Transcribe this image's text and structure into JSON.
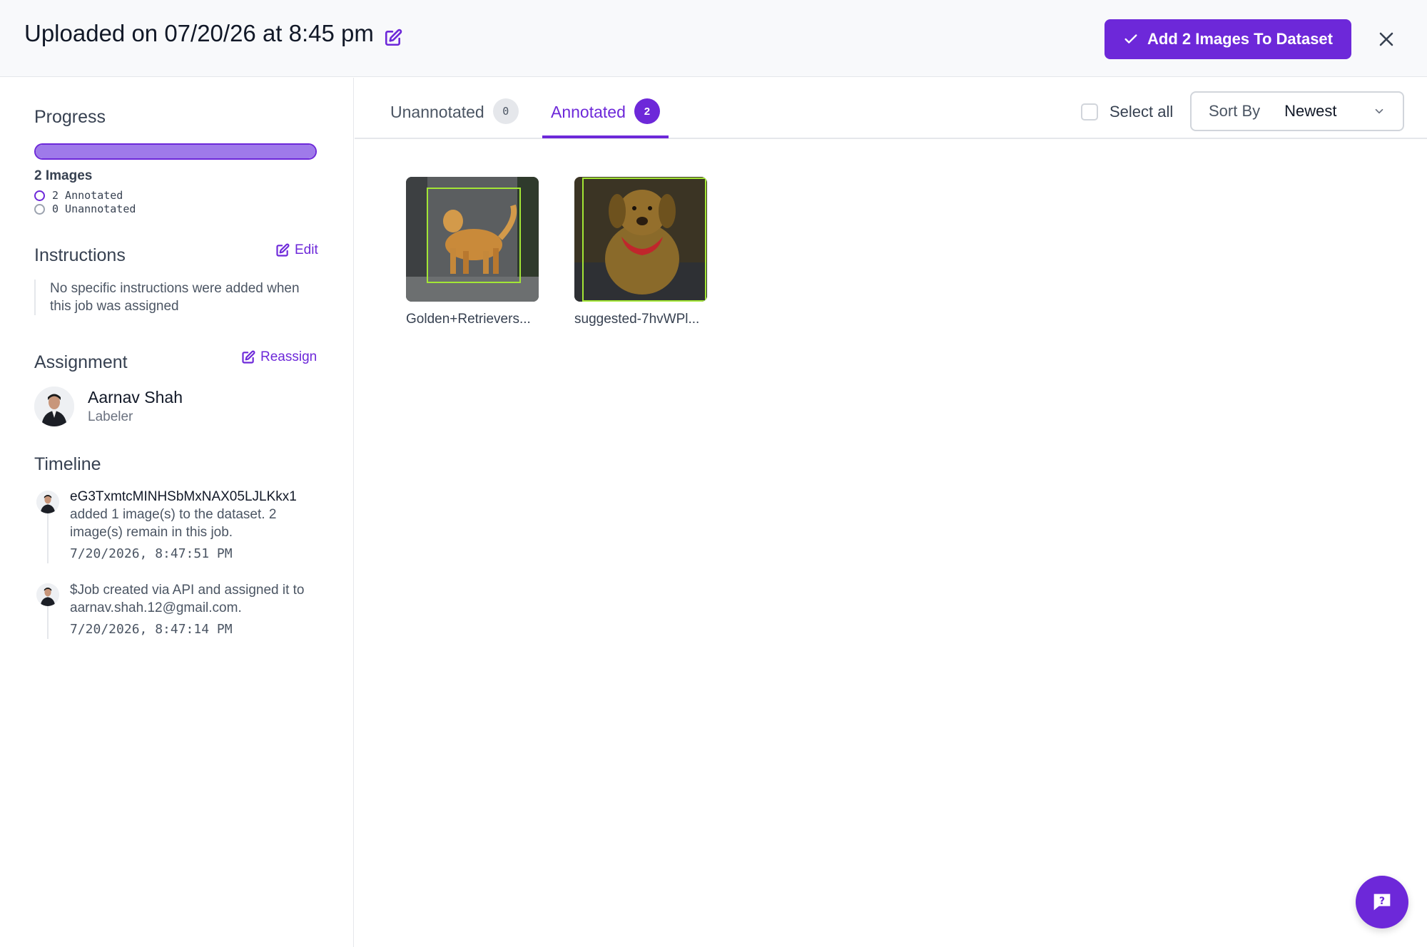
{
  "header": {
    "title": "Uploaded on 07/20/26 at 8:45 pm",
    "primary_button": "Add 2 Images To Dataset",
    "accent_color": "#6d28d9"
  },
  "sidebar": {
    "progress": {
      "title": "Progress",
      "fraction_annotated": 1.0,
      "images_label": "2 Images",
      "annotated_label": "2 Annotated",
      "unannotated_label": "0 Unannotated"
    },
    "instructions": {
      "title": "Instructions",
      "edit_label": "Edit",
      "text": "No specific instructions were added when this job was assigned"
    },
    "assignment": {
      "title": "Assignment",
      "reassign_label": "Reassign",
      "name": "Aarnav Shah",
      "role": "Labeler"
    },
    "timeline": {
      "title": "Timeline",
      "events": [
        {
          "actor": "eG3TxmtcMINHSbMxNAX05LJLKkx1",
          "text": "added 1 image(s) to the dataset. 2 image(s) remain in this job.",
          "time": "7/20/2026, 8:47:51 PM"
        },
        {
          "actor": "",
          "text": "$Job created via API and assigned it to aarnav.shah.12@gmail.com.",
          "time": "7/20/2026, 8:47:14 PM"
        }
      ]
    }
  },
  "main": {
    "tabs": [
      {
        "label": "Unannotated",
        "count": "0"
      },
      {
        "label": "Annotated",
        "count": "2"
      }
    ],
    "select_all_label": "Select all",
    "sort": {
      "label": "Sort By",
      "value": "Newest"
    },
    "images": [
      {
        "filename": "Golden+Retrievers..."
      },
      {
        "filename": "suggested-7hvWPl..."
      }
    ]
  }
}
